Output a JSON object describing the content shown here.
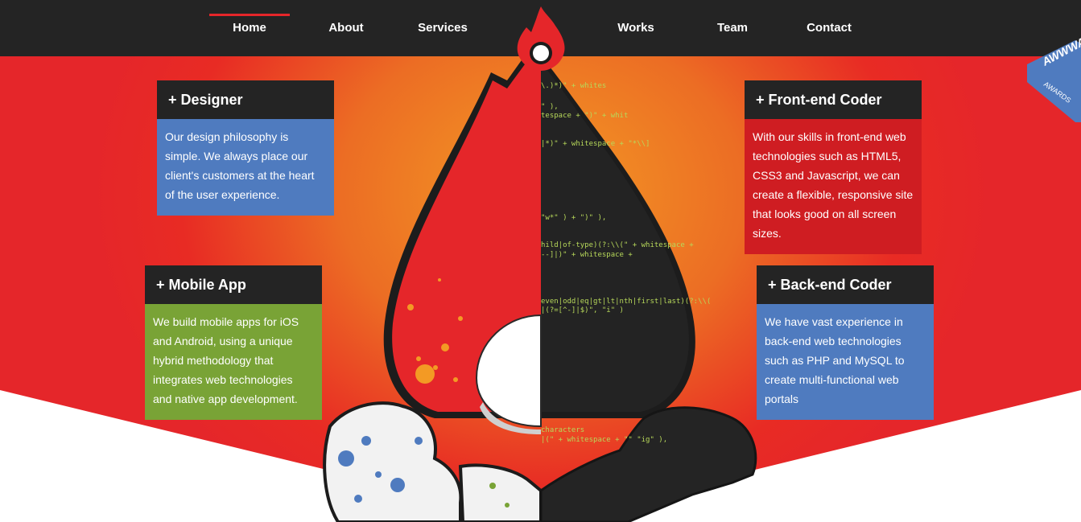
{
  "nav": {
    "items": [
      {
        "label": "Home",
        "active": true
      },
      {
        "label": "About",
        "active": false
      },
      {
        "label": "Services",
        "active": false
      },
      {
        "label": "Works",
        "active": false
      },
      {
        "label": "Team",
        "active": false
      },
      {
        "label": "Contact",
        "active": false
      }
    ],
    "logo_icon": "flame-logo-icon"
  },
  "badge": {
    "logo": "AWWWARDS",
    "label": "AWARDS"
  },
  "services": [
    {
      "title": "+ Designer",
      "text": "Our design philosophy is simple. We always place our client's customers at the heart of the user experience.",
      "color": "#4f7bbf"
    },
    {
      "title": "+ Mobile App",
      "text": "We build mobile apps for iOS and Android, using a unique hybrid methodology that integrates web technologies and native app development.",
      "color": "#79a336"
    },
    {
      "title": "+ Front-end Coder",
      "text": "With our skills in front-end web technologies such as HTML5, CSS3 and Javascript, we can create a flexible, responsive site that looks good on all screen sizes.",
      "color": "#cf1d22"
    },
    {
      "title": "+ Back-end Coder",
      "text": "We have vast experience in back-end web technologies such as PHP and MySQL to create multi-functional web portals",
      "color": "#4f7bbf"
    }
  ],
  "code_snippets": [
    "\\.)*)\" + whites",
    "\" ),",
    "tespace + \")\" + whit",
    "|*)\" + whitespace + \"*\\\\]",
    "\"w*\" ) + \")\" ),",
    "hild|of-type)(?:\\\\(\" + whitespace +",
    "--]|)\" + whitespace +",
    "even|odd|eq|gt|lt|nth|first|last)(?:\\\\(",
    "|(?=[^-]|$)\", \"i\" )",
    "characters",
    "|(\" + whitespace + \"\" \"ig\" ),"
  ],
  "colors": {
    "nav_bg": "#242424",
    "brand_red": "#e5262a",
    "orange": "#f39a24",
    "blue": "#4f7bbf",
    "green": "#79a336"
  }
}
